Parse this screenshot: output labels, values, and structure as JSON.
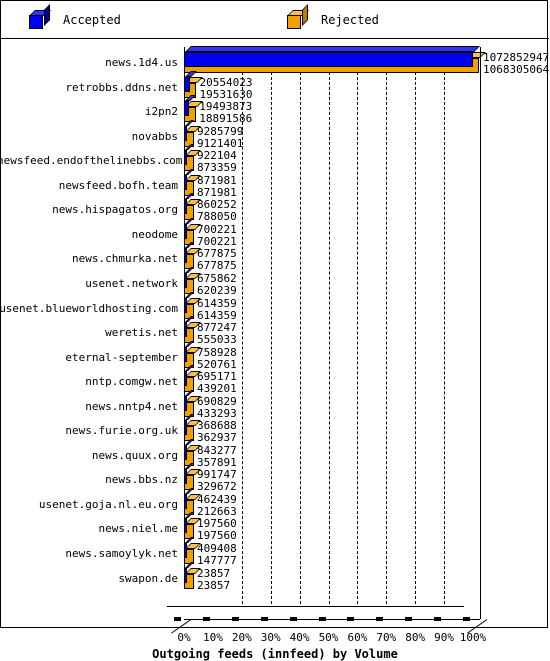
{
  "legend": {
    "items": [
      {
        "label": "Accepted",
        "color": "#0000ee",
        "icon": "blue-cube-icon"
      },
      {
        "label": "Rejected",
        "color": "#f0a000",
        "icon": "orange-cube-icon"
      }
    ]
  },
  "axis": {
    "x_title": "Outgoing feeds (innfeed) by Volume",
    "x_ticks": [
      "0%",
      "10%",
      "20%",
      "30%",
      "40%",
      "50%",
      "60%",
      "70%",
      "80%",
      "90%",
      "100%"
    ]
  },
  "chart_data": {
    "type": "bar",
    "title": "Outgoing feeds (innfeed) by Volume",
    "orientation": "horizontal",
    "xlabel": "Outgoing feeds (innfeed) by Volume",
    "ylabel": "",
    "xlim": [
      0,
      100
    ],
    "x_unit": "percent",
    "grid": true,
    "legend_position": "top",
    "categories": [
      "news.1d4.us",
      "retrobbs.ddns.net",
      "i2pn2",
      "novabbs",
      "newsfeed.endofthelinebbs.com",
      "newsfeed.bofh.team",
      "news.hispagatos.org",
      "neodome",
      "news.chmurka.net",
      "usenet.network",
      "usenet.blueworldhosting.com",
      "weretis.net",
      "eternal-september",
      "nntp.comgw.net",
      "news.nntp4.net",
      "news.furie.org.uk",
      "news.quux.org",
      "news.bbs.nz",
      "usenet.goja.nl.eu.org",
      "news.niel.me",
      "news.samoylyk.net",
      "swapon.de"
    ],
    "series": [
      {
        "name": "Accepted",
        "color": "#0000ee",
        "values": [
          1072852947,
          20554023,
          19493873,
          9285799,
          922104,
          871981,
          860252,
          700221,
          677875,
          675862,
          614359,
          877247,
          758928,
          695171,
          690829,
          368688,
          843277,
          991747,
          462439,
          197560,
          409408,
          23857
        ]
      },
      {
        "name": "Rejected",
        "color": "#f0a000",
        "values": [
          1068305064,
          19531630,
          18891586,
          9121401,
          873359,
          871981,
          788050,
          700221,
          677875,
          620239,
          614359,
          555033,
          520761,
          439201,
          433293,
          362937,
          357891,
          329672,
          212663,
          197560,
          147777,
          23857
        ]
      }
    ],
    "value_labels": [
      {
        "accepted": "1072852947",
        "rejected": "1068305064"
      },
      {
        "accepted": "20554023",
        "rejected": "19531630"
      },
      {
        "accepted": "19493873",
        "rejected": "18891586"
      },
      {
        "accepted": "9285799",
        "rejected": "9121401"
      },
      {
        "accepted": "922104",
        "rejected": "873359"
      },
      {
        "accepted": "871981",
        "rejected": "871981"
      },
      {
        "accepted": "860252",
        "rejected": "788050"
      },
      {
        "accepted": "700221",
        "rejected": "700221"
      },
      {
        "accepted": "677875",
        "rejected": "677875"
      },
      {
        "accepted": "675862",
        "rejected": "620239"
      },
      {
        "accepted": "614359",
        "rejected": "614359"
      },
      {
        "accepted": "877247",
        "rejected": "555033"
      },
      {
        "accepted": "758928",
        "rejected": "520761"
      },
      {
        "accepted": "695171",
        "rejected": "439201"
      },
      {
        "accepted": "690829",
        "rejected": "433293"
      },
      {
        "accepted": "368688",
        "rejected": "362937"
      },
      {
        "accepted": "843277",
        "rejected": "357891"
      },
      {
        "accepted": "991747",
        "rejected": "329672"
      },
      {
        "accepted": "462439",
        "rejected": "212663"
      },
      {
        "accepted": "197560",
        "rejected": "197560"
      },
      {
        "accepted": "409408",
        "rejected": "147777"
      },
      {
        "accepted": "23857",
        "rejected": "23857"
      }
    ]
  }
}
